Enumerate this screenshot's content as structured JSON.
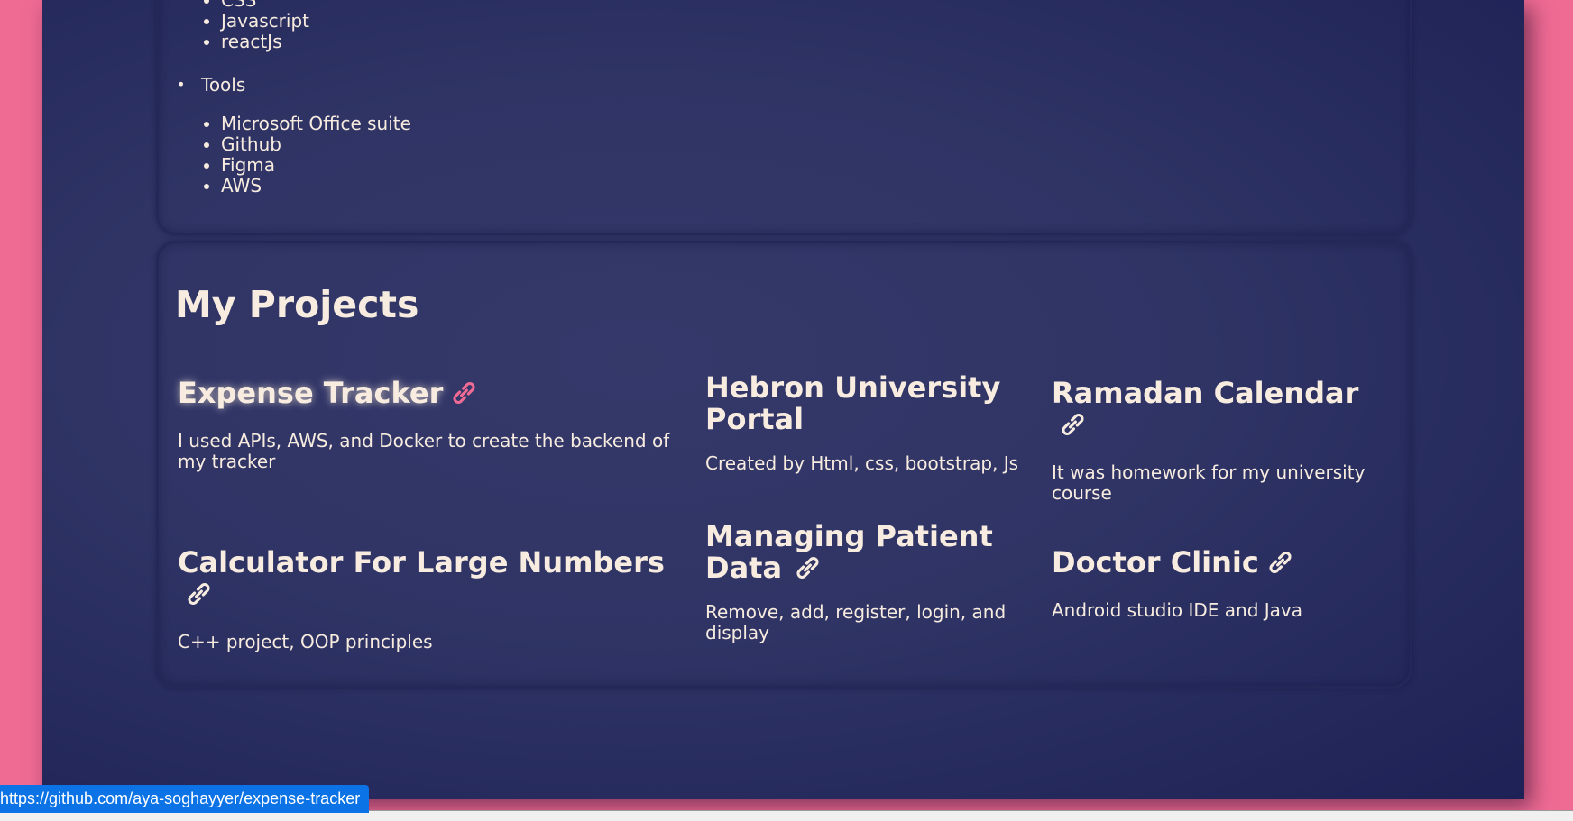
{
  "skills": {
    "frontend_items": [
      "CSS",
      "Javascript",
      "reactJs"
    ],
    "tools_label": "Tools",
    "tools_items": [
      "Microsoft Office suite",
      "Github",
      "Figma",
      "AWS"
    ]
  },
  "projects": {
    "title": "My Projects",
    "items": [
      {
        "name": "Expense Tracker",
        "description": "I used APIs, AWS, and Docker to create the backend of my tracker"
      },
      {
        "name": "Hebron University Portal",
        "description": "Created by Html, css, bootstrap, Js"
      },
      {
        "name": "Ramadan Calendar",
        "description": "It was homework for my university course"
      },
      {
        "name": "Calculator For Large Numbers",
        "description": "C++ project, OOP principles"
      },
      {
        "name": "Managing Patient Data",
        "description": "Remove, add, register, login, and display"
      },
      {
        "name": "Doctor Clinic",
        "description": "Android studio IDE and Java"
      }
    ]
  },
  "status_bar": {
    "url": "https://github.com/aya-soghayyer/expense-tracker"
  },
  "colors": {
    "background": "#ef6b94",
    "card": "#2f3465",
    "text": "#f7ecdf",
    "accent": "#ef6b94",
    "status_bar": "#0b73e6"
  }
}
